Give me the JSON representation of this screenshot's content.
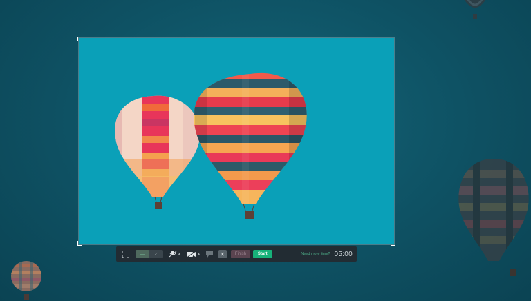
{
  "toolbar": {
    "fullscreen_icon": "fullscreen-icon",
    "mode_segment": {
      "left_label": "—",
      "right_label": "✓"
    },
    "mic_icon": "mic-muted-icon",
    "camera_icon": "camera-icon",
    "chat_icon": "chat-icon",
    "close_label": "✕",
    "finish_label": "Finish",
    "start_label": "Start",
    "need_more_time": "Need more time?",
    "timer": "05:00"
  },
  "colors": {
    "backdrop": "#0f4d5e",
    "capture_sky": "#0aa0b8",
    "toolbar_bg": "#222c33",
    "start_green": "#17b27a",
    "finish_muted": "#5a4450"
  }
}
